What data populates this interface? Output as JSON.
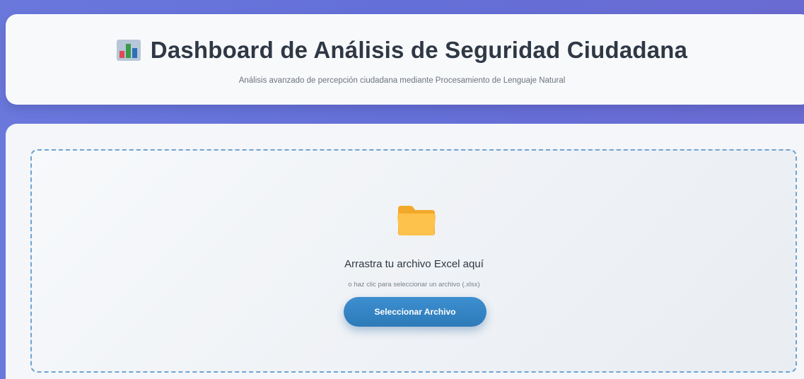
{
  "header": {
    "icon": "bar-chart-icon",
    "title": "Dashboard de Análisis de Seguridad Ciudadana",
    "subtitle": "Análisis avanzado de percepción ciudadana mediante Procesamiento de Lenguaje Natural"
  },
  "upload": {
    "icon": "folder-icon",
    "title": "Arrastra tu archivo Excel aquí",
    "hint": "o haz clic para seleccionar un archivo (.xlsx)",
    "button_label": "Seleccionar Archivo"
  },
  "colors": {
    "band": "#6470d8",
    "button": "#3388c8",
    "dropzone_border": "#6fa3d4",
    "folder": "#f7b733"
  }
}
